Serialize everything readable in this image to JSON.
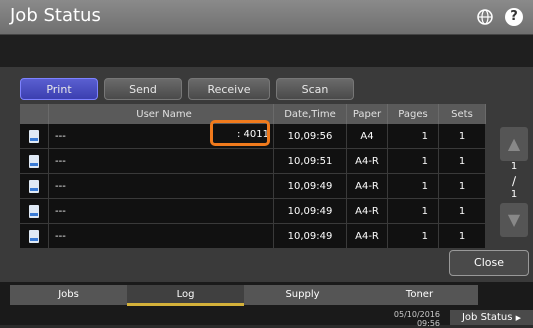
{
  "window": {
    "title": "Job Status"
  },
  "tabs": [
    "Print",
    "Send",
    "Receive",
    "Scan"
  ],
  "table": {
    "headers": [
      "User Name",
      "Date,Time",
      "Paper",
      "Pages",
      "Sets"
    ],
    "rows": [
      {
        "user": "---",
        "extra": ": 4011",
        "datetime": "10,09:56",
        "paper": "A4",
        "pages": "1",
        "sets": "1"
      },
      {
        "user": "---",
        "extra": "",
        "datetime": "10,09:51",
        "paper": "A4-R",
        "pages": "1",
        "sets": "1"
      },
      {
        "user": "---",
        "extra": "",
        "datetime": "10,09:49",
        "paper": "A4-R",
        "pages": "1",
        "sets": "1"
      },
      {
        "user": "---",
        "extra": "",
        "datetime": "10,09:49",
        "paper": "A4-R",
        "pages": "1",
        "sets": "1"
      },
      {
        "user": "---",
        "extra": "",
        "datetime": "10,09:49",
        "paper": "A4-R",
        "pages": "1",
        "sets": "1"
      }
    ]
  },
  "pager": {
    "current": "1",
    "total": "1"
  },
  "buttons": {
    "close": "Close"
  },
  "bottom_tabs": [
    "Jobs",
    "Log",
    "Supply",
    "Toner"
  ],
  "footer": {
    "date": "05/10/2016",
    "time": "09:56",
    "job_status": "Job Status"
  },
  "colors": {
    "accent": "#3b3fb0",
    "highlight": "#f07a1c",
    "tab_underline": "#d4b13a"
  }
}
